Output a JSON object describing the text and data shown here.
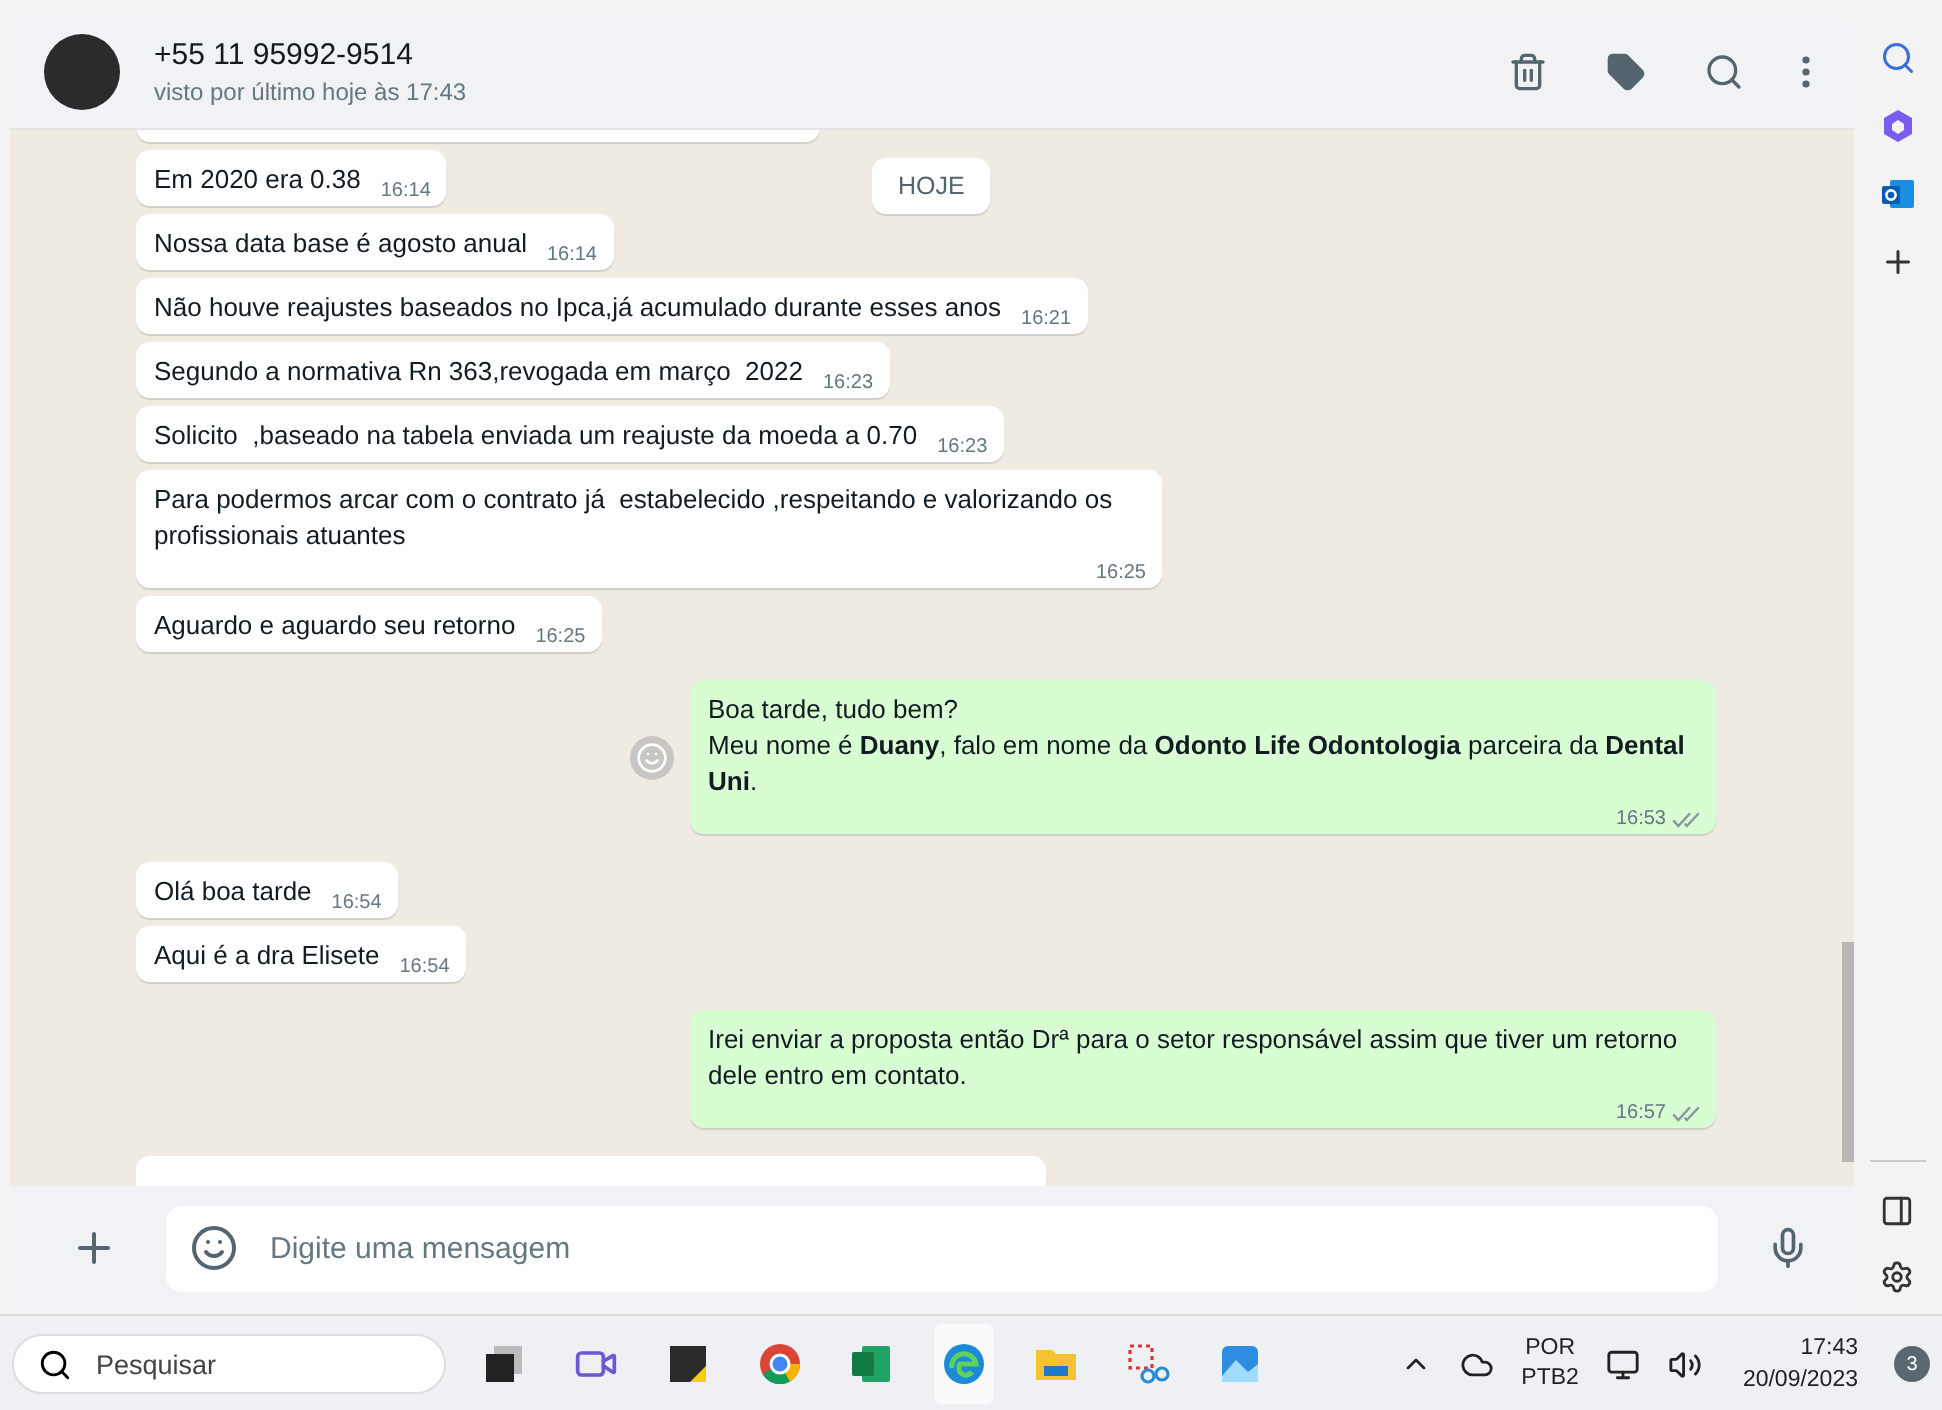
{
  "contact": {
    "name": "+55 11 95992-9514",
    "status": "visto por último hoje às 17:43"
  },
  "date_marker": "HOJE",
  "messages": [
    {
      "kind": "partial"
    },
    {
      "kind": "in",
      "text": "Em 2020 era 0.38",
      "time": "16:14"
    },
    {
      "kind": "in",
      "text": "Nossa data base é agosto anual",
      "time": "16:14"
    },
    {
      "kind": "in",
      "text": "Não houve reajustes baseados no Ipca,já acumulado durante esses anos",
      "time": "16:21"
    },
    {
      "kind": "in",
      "text": "Segundo a normativa Rn 363,revogada em março  2022",
      "time": "16:23"
    },
    {
      "kind": "in",
      "text": "Solicito  ,baseado na tabela enviada um reajuste da moeda a 0.70",
      "time": "16:23"
    },
    {
      "kind": "in",
      "text": "Para podermos arcar com o contrato já  estabelecido ,respeitando e valorizando os profissionais atuantes",
      "time": "16:25"
    },
    {
      "kind": "in",
      "text": "Aguardo e aguardo seu retorno",
      "time": "16:25"
    },
    {
      "kind": "out",
      "text": "Boa tarde, tudo bem?\nMeu nome é **Duany**, falo em nome da **Odonto Life Odontologia** parceira da **Dental Uni**.",
      "time": "16:53",
      "read": false,
      "reaction_button": true
    },
    {
      "kind": "in",
      "text": "Olá boa tarde",
      "time": "16:54"
    },
    {
      "kind": "in",
      "text": "Aqui é a dra Elisete",
      "time": "16:54"
    },
    {
      "kind": "out",
      "text": "Irei enviar a proposta então Drª para o setor responsável assim que tiver um retorno dele entro em contato.",
      "time": "16:57",
      "read": false,
      "reaction_button": false
    },
    {
      "kind": "partial"
    }
  ],
  "composer": {
    "placeholder": "Digite uma mensagem"
  },
  "taskbar": {
    "search_placeholder": "Pesquisar",
    "language": "POR",
    "layout": "PTB2",
    "time": "17:43",
    "date": "20/09/2023",
    "notifications": "3"
  }
}
